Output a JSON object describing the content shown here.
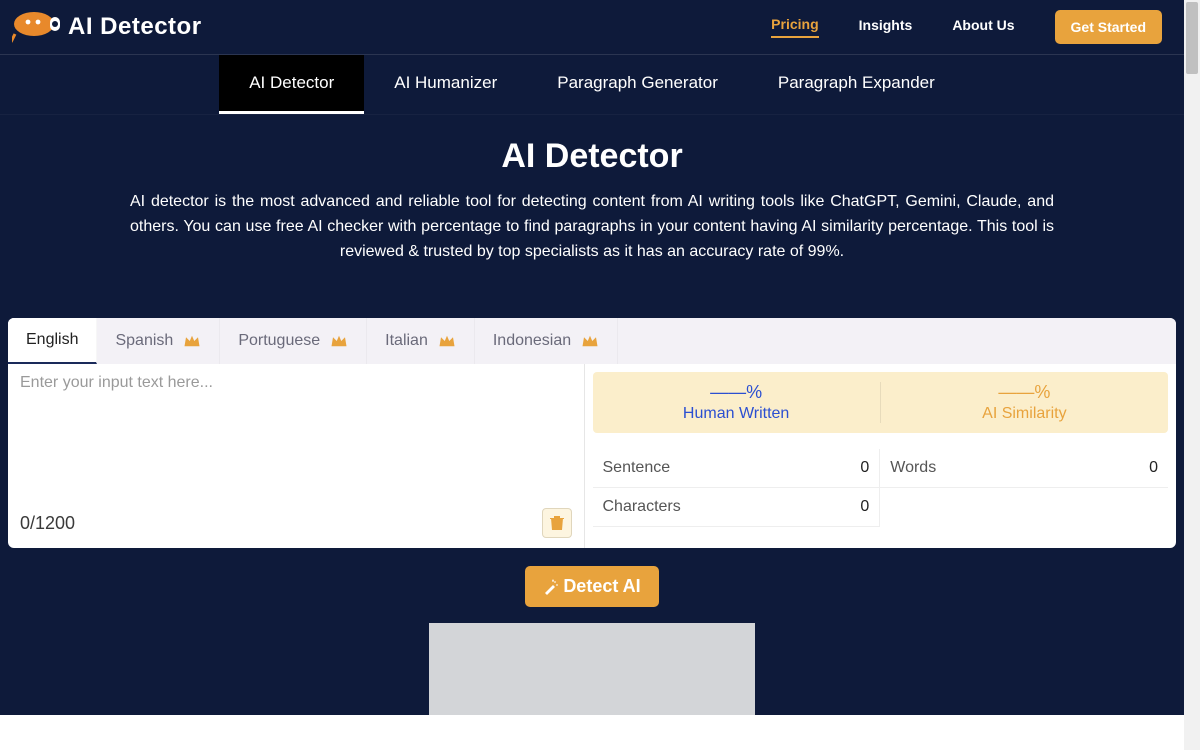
{
  "brand": {
    "name": "AI Detector"
  },
  "nav": {
    "pricing": "Pricing",
    "insights": "Insights",
    "about": "About Us",
    "cta": "Get Started"
  },
  "subtabs": {
    "detector": "AI Detector",
    "humanizer": "AI Humanizer",
    "paragen": "Paragraph Generator",
    "paraexp": "Paragraph Expander"
  },
  "hero": {
    "title": "AI Detector",
    "body": "AI detector is the most advanced and reliable tool for detecting content from AI writing tools like ChatGPT, Gemini, Claude, and others. You can use free AI checker with percentage to find paragraphs in your content having AI similarity percentage. This tool is reviewed & trusted by top specialists as it has an accuracy rate of 99%."
  },
  "langs": {
    "en": "English",
    "es": "Spanish",
    "pt": "Portuguese",
    "it": "Italian",
    "id": "Indonesian"
  },
  "input": {
    "placeholder": "Enter your input text here...",
    "counter": "0/1200"
  },
  "results": {
    "human_pct": "——%",
    "human_label": "Human Written",
    "ai_pct": "——%",
    "ai_label": "AI Similarity"
  },
  "stats": {
    "sentence_label": "Sentence",
    "sentence_val": "0",
    "words_label": "Words",
    "words_val": "0",
    "chars_label": "Characters",
    "chars_val": "0"
  },
  "detect_label": "Detect AI"
}
